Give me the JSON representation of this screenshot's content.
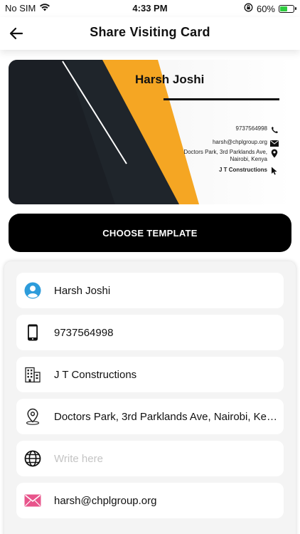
{
  "status_bar": {
    "carrier": "No SIM",
    "time": "4:33 PM",
    "battery_percent": "60%",
    "battery_level": 0.6,
    "icons": [
      "wifi-icon",
      "orientation-lock-icon",
      "battery-charging-icon"
    ]
  },
  "header": {
    "title": "Share Visiting Card",
    "back_icon": "arrow-left-icon"
  },
  "card": {
    "name": "Harsh Joshi",
    "phone": "9737564998",
    "email": "harsh@chplgroup.org",
    "address_line1": "Doctors Park, 3rd Parklands Ave,",
    "address_line2": "Nairobi, Kenya",
    "company": "J T Constructions",
    "colors": {
      "dark": "#1e2329",
      "accent": "#f5a623",
      "background": "#f4f4f4"
    }
  },
  "choose_template_label": "CHOOSE TEMPLATE",
  "form": {
    "name": {
      "value": "Harsh Joshi",
      "icon": "user-icon"
    },
    "phone": {
      "value": "9737564998",
      "icon": "mobile-phone-icon"
    },
    "company": {
      "value": "J T Constructions",
      "icon": "building-icon"
    },
    "address": {
      "value": "Doctors Park, 3rd Parklands Ave, Nairobi, Kenya",
      "icon": "location-pin-icon"
    },
    "website": {
      "value": "",
      "placeholder": "Write here",
      "icon": "globe-icon"
    },
    "email": {
      "value": "harsh@chplgroup.org",
      "icon": "envelope-icon"
    }
  }
}
